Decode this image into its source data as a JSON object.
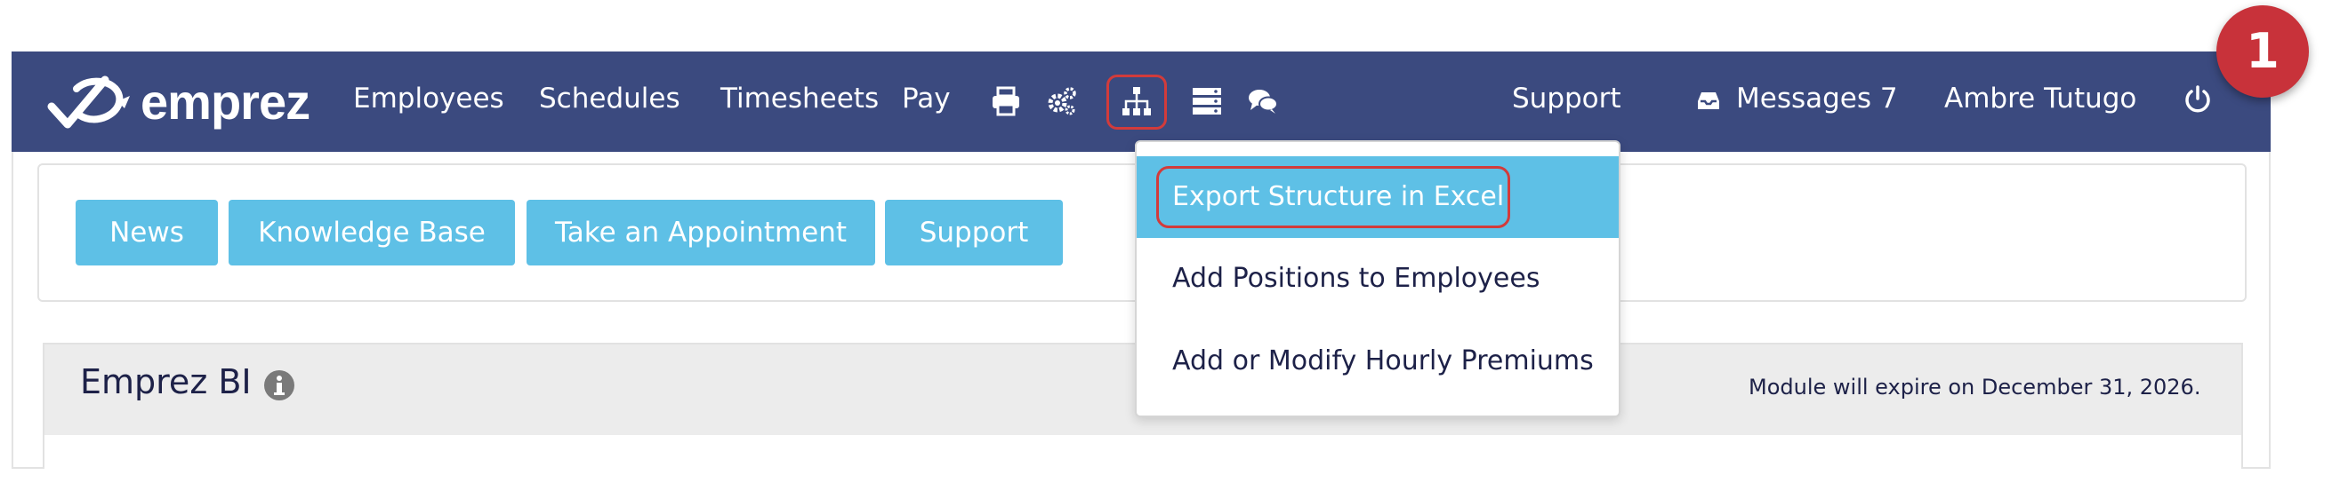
{
  "step_badge": "1",
  "brand": {
    "name": "emprez"
  },
  "nav": {
    "links": [
      "Employees",
      "Schedules",
      "Timesheets",
      "Pay"
    ],
    "icons": [
      "printer-icon",
      "gears-icon",
      "org-chart-icon",
      "server-icon",
      "chat-icon"
    ],
    "support": "Support",
    "messages": "Messages 7",
    "user": "Ambre Tutugo"
  },
  "quick_links": [
    "News",
    "Knowledge Base",
    "Take an Appointment",
    "Support"
  ],
  "dropdown": {
    "items": [
      "Export Structure in Excel",
      "Add Positions to Employees",
      "Add or Modify Hourly Premiums"
    ]
  },
  "module": {
    "title": "Emprez BI",
    "expiry": "Module will expire on December 31, 2026."
  },
  "colors": {
    "navbar": "#3b4a7f",
    "button": "#5ec0e6",
    "highlight": "#d23b3b"
  }
}
